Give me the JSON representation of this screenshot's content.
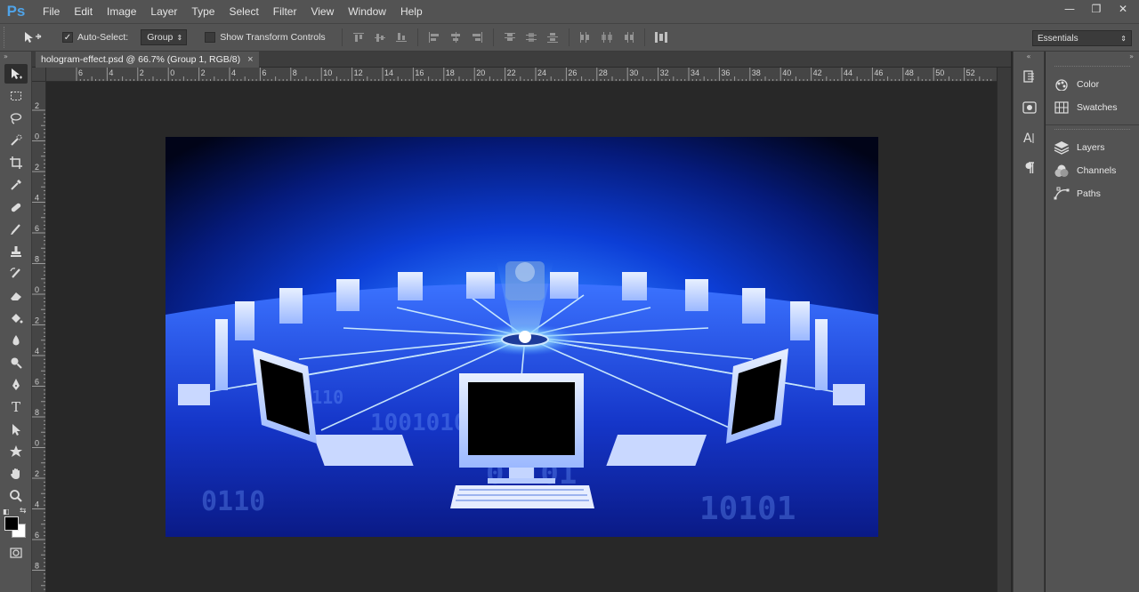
{
  "app": {
    "logo": "Ps"
  },
  "menu": [
    "File",
    "Edit",
    "Image",
    "Layer",
    "Type",
    "Select",
    "Filter",
    "View",
    "Window",
    "Help"
  ],
  "window_controls": {
    "minimize": "—",
    "restore": "❐",
    "close": "✕"
  },
  "options": {
    "auto_select_label": "Auto-Select:",
    "auto_select_checked": true,
    "group_value": "Group",
    "show_transform_label": "Show Transform Controls",
    "show_transform_checked": false,
    "workspace_value": "Essentials"
  },
  "document": {
    "tab_title": "hologram-effect.psd @ 66.7% (Group 1, RGB/8)",
    "close_glyph": "×"
  },
  "ruler_top_labels": [
    "6",
    "4",
    "2",
    "0",
    "2",
    "4",
    "6",
    "8",
    "10",
    "12",
    "14",
    "16",
    "18",
    "20",
    "22",
    "24",
    "26",
    "28",
    "30",
    "32",
    "34",
    "36",
    "38",
    "40",
    "42",
    "44",
    "46",
    "48",
    "50",
    "52"
  ],
  "ruler_left_labels": [
    "2",
    "0",
    "2",
    "4",
    "6",
    "8",
    "0",
    "2",
    "4",
    "6",
    "8",
    "0",
    "2",
    "4",
    "6",
    "8",
    "2"
  ],
  "toolbar_tools": [
    "move-tool",
    "marquee-tool",
    "lasso-tool",
    "quick-selection-tool",
    "crop-tool",
    "eyedropper-tool",
    "spot-healing-tool",
    "brush-tool",
    "clone-stamp-tool",
    "history-brush-tool",
    "eraser-tool",
    "paint-bucket-tool",
    "blur-tool",
    "dodge-tool",
    "pen-tool",
    "type-tool",
    "path-selection-tool",
    "shape-tool",
    "hand-tool",
    "zoom-tool"
  ],
  "colors": {
    "foreground": "#000000",
    "background": "#ffffff"
  },
  "dock_icons": [
    "history-icon",
    "properties-icon",
    "character-icon",
    "paragraph-icon"
  ],
  "panels": {
    "group1": [
      {
        "label": "Color",
        "icon": "color-icon"
      },
      {
        "label": "Swatches",
        "icon": "swatches-icon"
      }
    ],
    "group2": [
      {
        "label": "Layers",
        "icon": "layers-icon"
      },
      {
        "label": "Channels",
        "icon": "channels-icon"
      },
      {
        "label": "Paths",
        "icon": "paths-icon"
      }
    ]
  }
}
